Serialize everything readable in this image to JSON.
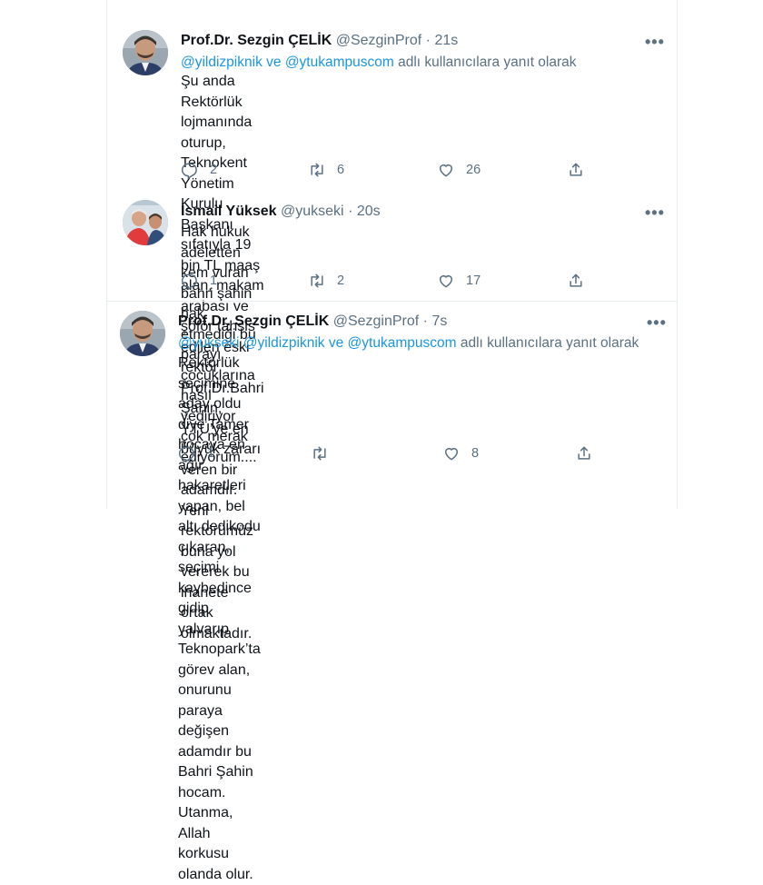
{
  "tweets": [
    {
      "name": "Prof.Dr. Sezgin ÇELİK",
      "handle": "@SezginProf",
      "time": "21s",
      "reply_mention_1": "@yildizpiknik",
      "reply_joiner": " ve ",
      "reply_mention_2": "@ytukampuscom",
      "reply_suffix": " adlı kullanıcılara yanıt olarak",
      "body_lines": [
        "Şu anda Rektörlük lojmanında oturup, Teknokent Yönetim Kurulu Başkanı",
        "sıfatıyla 19 bin TL maaş alan, makam arabası ve şöför tahsis edilen eski",
        "rektör Prof.Dr.Bahri Şahin, YTÜ’ye en büyük zararı veren bir adamdır. Yeni",
        "rektörümüz buna yol vererek bu ihanete ortak olmaktadır."
      ],
      "replies": "2",
      "retweets": "6",
      "likes": "26"
    },
    {
      "name": "İsmail Yüksek",
      "handle": "@yukseki",
      "time": "20s",
      "body_lines": [
        "Hak hukuk adeletten kem vuran bahri şahin hak etmediği bu parayı",
        "çocuklarına nasıl yediriyor çok merak ediyorum...."
      ],
      "replies": "1",
      "retweets": "2",
      "likes": "17"
    },
    {
      "name": "Prof.Dr. Sezgin ÇELİK",
      "handle": "@SezginProf",
      "time": "7s",
      "reply_mention_0": "@yukseki",
      "reply_mention_1": "@yildizpiknik",
      "reply_joiner": " ve ",
      "reply_mention_2": "@ytukampuscom",
      "reply_suffix": " adlı kullanıcılara yanıt olarak",
      "body_lines": [
        "Rektörlük seçimine aday oldu diye Tamer hocaya en ağır hakaretleri",
        "yapan, bel altı dedikodu çıkaran, seçimi kaybedince gidip yalvarıp",
        "Teknopark’ta görev alan, onurunu paraya değişen adamdır bu Bahri Şahin",
        "hocam. Utanma, Allah korkusu olanda olur."
      ],
      "replies": "1",
      "retweets": "",
      "likes": "8"
    }
  ],
  "ui": {
    "dot": "·",
    "more": "•••"
  },
  "icons": {
    "reply": "reply-icon",
    "retweet": "retweet-icon",
    "like": "heart-icon",
    "share": "share-icon",
    "more": "more-icon"
  },
  "colors": {
    "text": "#0f1419",
    "muted": "#5b7083",
    "link": "#1b95e0",
    "divider": "#e6ecf0"
  }
}
